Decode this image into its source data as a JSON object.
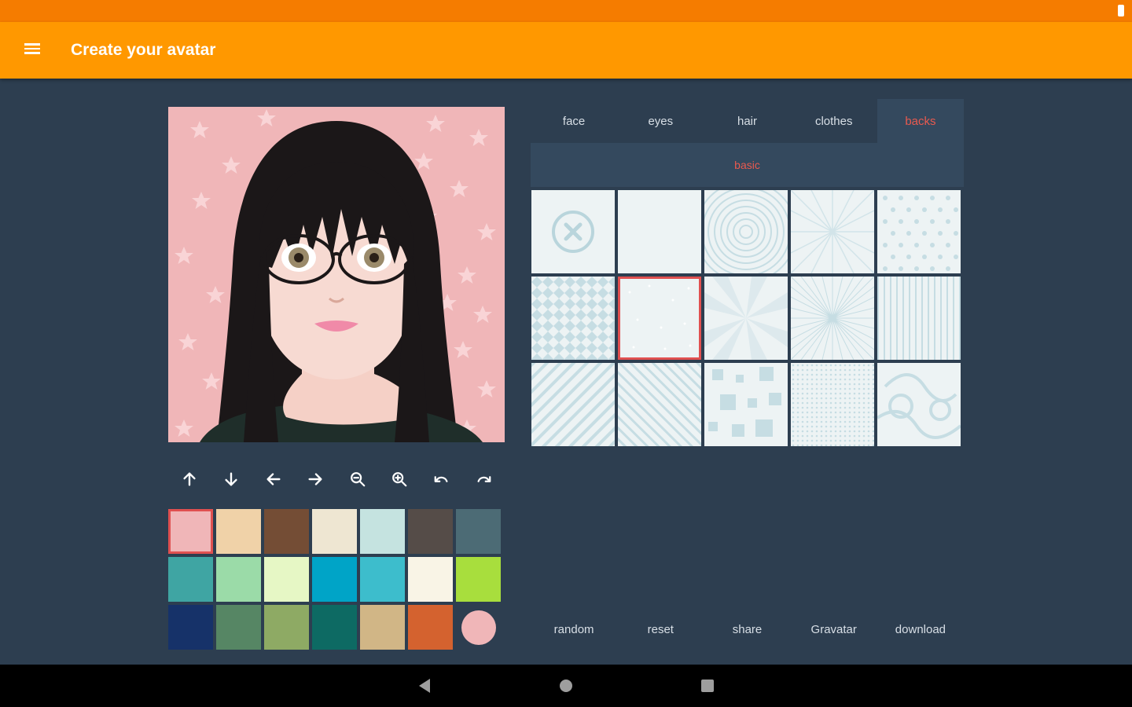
{
  "app": {
    "title": "Create your avatar"
  },
  "colors": {
    "accent": "#ff9800",
    "selected": "#e85a4f",
    "background": "#2d3e50"
  },
  "tabs": [
    {
      "label": "face"
    },
    {
      "label": "eyes"
    },
    {
      "label": "hair"
    },
    {
      "label": "clothes"
    },
    {
      "label": "backs",
      "active": true
    }
  ],
  "subtabs": [
    {
      "label": "basic",
      "active": true
    }
  ],
  "toolbar": [
    "arrow-up-icon",
    "arrow-down-icon",
    "arrow-left-icon",
    "arrow-right-icon",
    "zoom-out-icon",
    "zoom-in-icon",
    "undo-icon",
    "redo-icon"
  ],
  "swatches": [
    "#f0b6b8",
    "#f0d2a8",
    "#744d35",
    "#eee6d2",
    "#c5e3e0",
    "#554c48",
    "#4c6b75",
    "#3fa5a3",
    "#9bdba8",
    "#e6f7c5",
    "#00a4c7",
    "#3dbdcc",
    "#f9f4e6",
    "#a8de3d",
    "#163269",
    "#568664",
    "#8eaa64",
    "#0d6a63",
    "#d1b686",
    "#d4622f",
    "#f0b6b8"
  ],
  "selected_swatch": 0,
  "backgrounds": [
    "none",
    "plain",
    "circles",
    "rays",
    "hearts",
    "diamonds",
    "dots",
    "burst",
    "sunburst",
    "vertical-stripes",
    "diagonal-stripes",
    "diagonal-stripes-2",
    "squares",
    "grid",
    "swirls"
  ],
  "selected_background": 6,
  "actions": [
    {
      "label": "random"
    },
    {
      "label": "reset"
    },
    {
      "label": "share"
    },
    {
      "label": "Gravatar"
    },
    {
      "label": "download"
    }
  ]
}
